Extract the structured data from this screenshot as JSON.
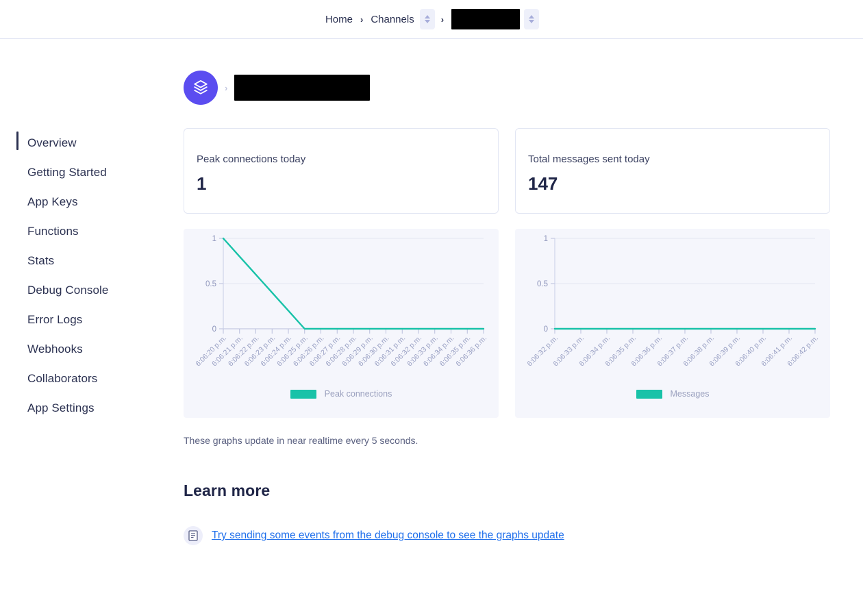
{
  "breadcrumb": {
    "home_label": "Home",
    "channels_label": "Channels",
    "separator": "›",
    "app_name_redacted": true,
    "channels_spinner_icon": "chevron-up-down-icon",
    "app_spinner_icon": "chevron-up-down-icon"
  },
  "app_header": {
    "logo_icon": "pusher-logo-icon",
    "separator": "›",
    "app_name_redacted": true
  },
  "sidebar": {
    "items": [
      {
        "label": "Overview",
        "active": true
      },
      {
        "label": "Getting Started",
        "active": false
      },
      {
        "label": "App Keys",
        "active": false
      },
      {
        "label": "Functions",
        "active": false
      },
      {
        "label": "Stats",
        "active": false
      },
      {
        "label": "Debug Console",
        "active": false
      },
      {
        "label": "Error Logs",
        "active": false
      },
      {
        "label": "Webhooks",
        "active": false
      },
      {
        "label": "Collaborators",
        "active": false
      },
      {
        "label": "App Settings",
        "active": false
      }
    ]
  },
  "stats": {
    "peak_connections": {
      "label": "Peak connections today",
      "value": "1"
    },
    "total_messages": {
      "label": "Total messages sent today",
      "value": "147"
    }
  },
  "note": "These graphs update in near realtime every 5 seconds.",
  "learn_more": {
    "title": "Learn more",
    "items": [
      {
        "icon": "document-icon",
        "text": "Try sending some events from the debug console to see the graphs update"
      }
    ]
  },
  "colors": {
    "accent_teal": "#19c2a8",
    "brand_purple": "#5b4df0",
    "link_blue": "#1f6feb",
    "chart_bg": "#f5f6fc",
    "text_dark": "#2b3151",
    "grid": "#dfe3f3"
  },
  "chart_data": [
    {
      "id": "peak-connections-chart",
      "type": "line",
      "title": "",
      "xlabel": "",
      "ylabel": "",
      "ylim": [
        0,
        1
      ],
      "yticks": [
        0,
        0.5,
        1
      ],
      "ytick_labels": [
        "0",
        "0.5",
        "1"
      ],
      "grid": true,
      "legend": {
        "position": "bottom",
        "entries": [
          "Peak connections"
        ]
      },
      "series": [
        {
          "name": "Peak connections",
          "color": "#19c2a8",
          "values": [
            1,
            0.8,
            0.6,
            0.4,
            0.2,
            0,
            0,
            0,
            0,
            0,
            0,
            0,
            0,
            0,
            0,
            0,
            0
          ]
        }
      ],
      "categories": [
        "6:06:20 p.m.",
        "6:06:21 p.m.",
        "6:06:22 p.m.",
        "6:06:23 p.m.",
        "6:06:24 p.m.",
        "6:06:25 p.m.",
        "6:06:26 p.m.",
        "6:06:27 p.m.",
        "6:06:28 p.m.",
        "6:06:29 p.m.",
        "6:06:30 p.m.",
        "6:06:31 p.m.",
        "6:06:32 p.m.",
        "6:06:33 p.m.",
        "6:06:34 p.m.",
        "6:06:35 p.m.",
        "6:06:36 p.m."
      ]
    },
    {
      "id": "messages-chart",
      "type": "line",
      "title": "",
      "xlabel": "",
      "ylabel": "",
      "ylim": [
        0,
        1
      ],
      "yticks": [
        0,
        0.5,
        1
      ],
      "ytick_labels": [
        "0",
        "0.5",
        "1"
      ],
      "grid": true,
      "legend": {
        "position": "bottom",
        "entries": [
          "Messages"
        ]
      },
      "series": [
        {
          "name": "Messages",
          "color": "#19c2a8",
          "values": [
            0,
            0,
            0,
            0,
            0,
            0,
            0,
            0,
            0,
            0,
            0
          ]
        }
      ],
      "categories": [
        "6:06:32 p.m.",
        "6:06:33 p.m.",
        "6:06:34 p.m.",
        "6:06:35 p.m.",
        "6:06:36 p.m.",
        "6:06:37 p.m.",
        "6:06:38 p.m.",
        "6:06:39 p.m.",
        "6:06:40 p.m.",
        "6:06:41 p.m.",
        "6:06:42 p.m."
      ]
    }
  ]
}
